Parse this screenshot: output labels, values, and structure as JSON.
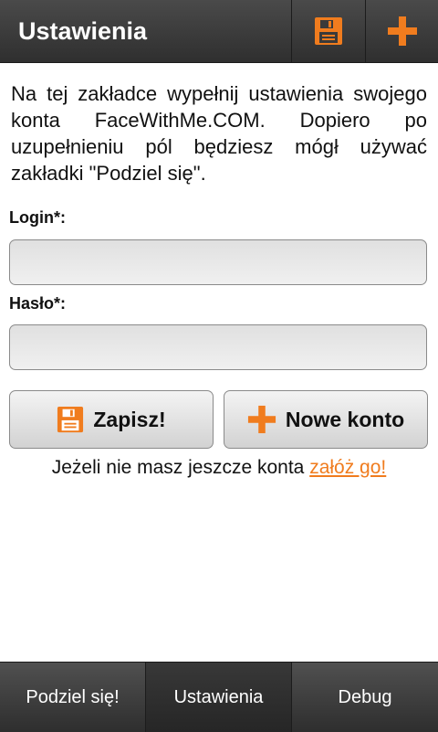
{
  "header": {
    "title": "Ustawienia",
    "save_icon": "floppy-disk-icon",
    "add_icon": "plus-icon",
    "accent_color": "#f07c1e"
  },
  "intro": {
    "text": "Na tej zakładce wypełnij ustawienia swojego konta FaceWithMe.COM. Dopiero po uzupełnieniu pól będziesz mógł używać zakładki \"Podziel się\"."
  },
  "form": {
    "login_label": "Login",
    "password_label": "Hasło",
    "required_mark": "*",
    "colon": ":",
    "login_value": "",
    "password_value": ""
  },
  "buttons": {
    "save_label": "Zapisz!",
    "new_account_label": "Nowe konto"
  },
  "signup": {
    "text": "Jeżeli nie masz jeszcze konta ",
    "link_text": "załóż go!"
  },
  "tabs": [
    {
      "label": "Podziel się!"
    },
    {
      "label": "Ustawienia",
      "active": true
    },
    {
      "label": "Debug"
    }
  ]
}
